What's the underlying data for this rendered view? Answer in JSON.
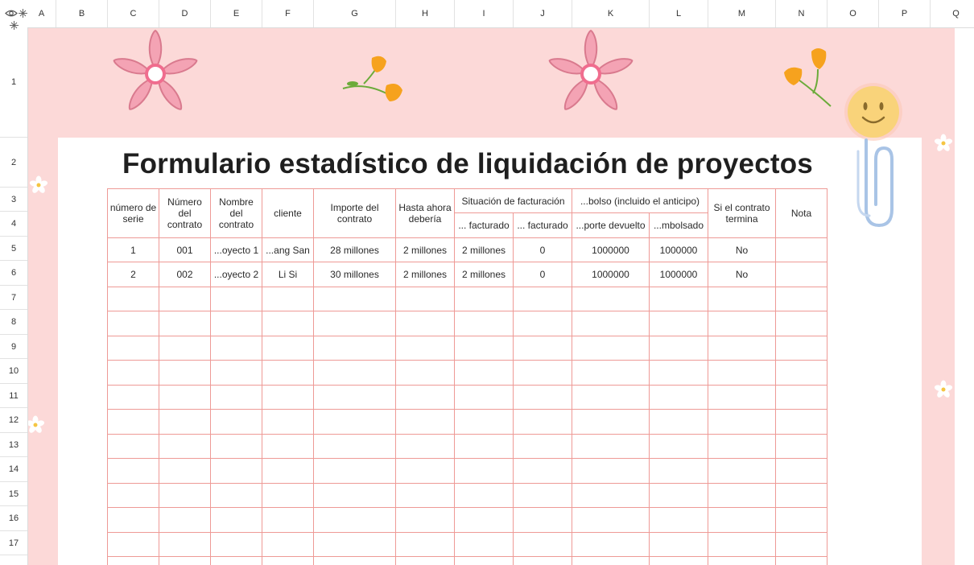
{
  "columns": [
    "A",
    "B",
    "C",
    "D",
    "E",
    "F",
    "G",
    "H",
    "I",
    "J",
    "K",
    "L",
    "M",
    "N",
    "O",
    "P",
    "Q"
  ],
  "rows": [
    "1",
    "2",
    "3",
    "4",
    "5",
    "6",
    "7",
    "8",
    "9",
    "10",
    "11",
    "12",
    "13",
    "14",
    "15",
    "16",
    "17"
  ],
  "title": "Formulario estadístico de liquidación de proyectos",
  "headers": {
    "serial": "número de serie",
    "contract_no": "Número del contrato",
    "contract_name": "Nombre del contrato",
    "client": "cliente",
    "amount": "Importe del contrato",
    "owed": "Hasta ahora debería",
    "billing": "Situación de facturación",
    "billed": "... facturado",
    "unbilled": "... facturado",
    "refund": "...bolso (incluido el anticipo)",
    "returned": "...porte devuelto",
    "reimbursed": "...mbolsado",
    "ends": "Si el contrato termina",
    "note": "Nota"
  },
  "data_rows": [
    {
      "serial": "1",
      "contract_no": "001",
      "contract_name": "...oyecto 1",
      "client": "...ang San",
      "amount": "28 millones",
      "owed": "2 millones",
      "billed": "2 millones",
      "unbilled": "0",
      "returned": "1000000",
      "reimbursed": "1000000",
      "ends": "No",
      "note": ""
    },
    {
      "serial": "2",
      "contract_no": "002",
      "contract_name": "...oyecto 2",
      "client": "Li Si",
      "amount": "30 millones",
      "owed": "2 millones",
      "billed": "2 millones",
      "unbilled": "0",
      "returned": "1000000",
      "reimbursed": "1000000",
      "ends": "No",
      "note": ""
    }
  ],
  "colors": {
    "accent_pink": "#fcd9d8",
    "grid_line": "#ee9a96",
    "flower": "#f4a3b4",
    "tulip": "#f6a21e"
  },
  "icons": [
    "eye-icon",
    "freeze-icon",
    "flower-icon",
    "tulip-icon",
    "smiley-icon",
    "paperclip-icon",
    "daisy-icon"
  ]
}
